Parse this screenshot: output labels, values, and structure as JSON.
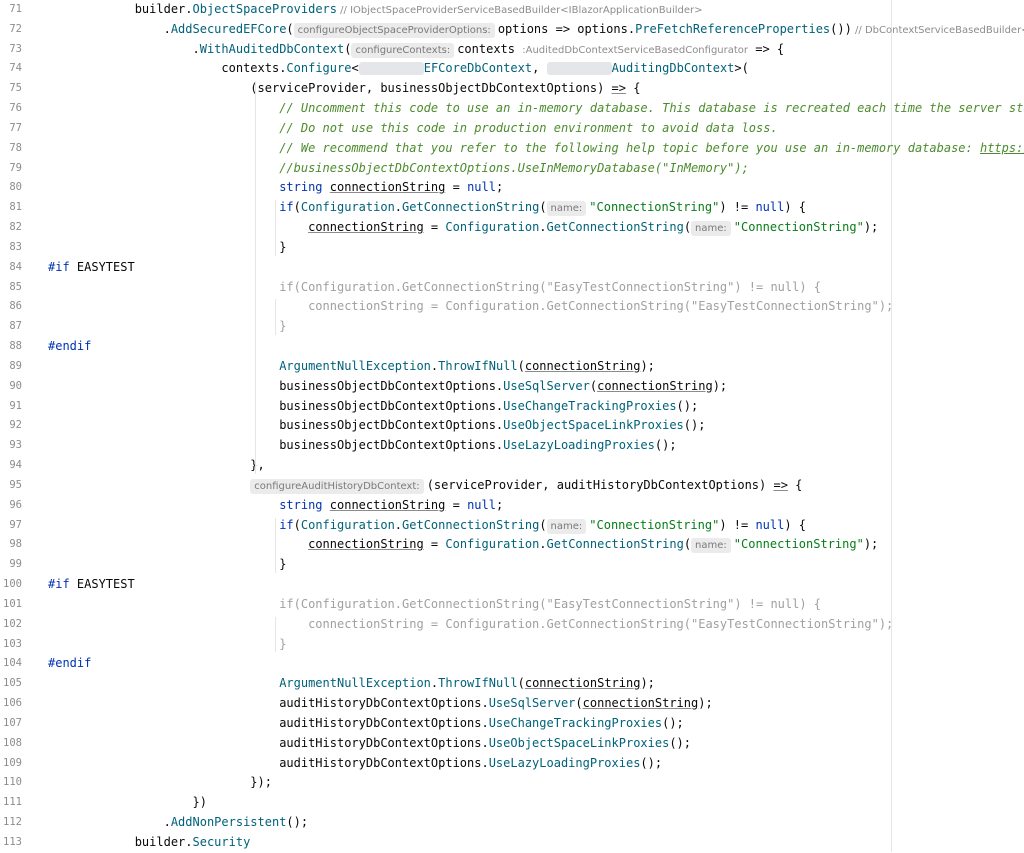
{
  "lines": [
    {
      "n": "71",
      "parts": [
        {
          "t": "            builder."
        },
        {
          "t": "ObjectSpaceProviders",
          "c": "method"
        },
        {
          "t": " // ",
          "c": "hint-plain"
        },
        {
          "t": "IObjectSpaceProviderServiceBasedBuilder<IBlazorApplicationBuilder>",
          "c": "hint-plain"
        }
      ]
    },
    {
      "n": "72",
      "parts": [
        {
          "t": "                ."
        },
        {
          "t": "AddSecuredEFCore",
          "c": "method"
        },
        {
          "t": "("
        },
        {
          "t": "configureObjectSpaceProviderOptions:",
          "c": "hint"
        },
        {
          "t": "options => options."
        },
        {
          "t": "PreFetchReferenceProperties",
          "c": "method"
        },
        {
          "t": "())"
        },
        {
          "t": " // DbContextServiceBasedBuilder<IB",
          "c": "hint-plain"
        }
      ]
    },
    {
      "n": "73",
      "parts": [
        {
          "t": "                    ."
        },
        {
          "t": "WithAuditedDbContext",
          "c": "method"
        },
        {
          "t": "("
        },
        {
          "t": "configureContexts:",
          "c": "hint"
        },
        {
          "t": "contexts "
        },
        {
          "t": ":AuditedDbContextServiceBasedConfigurator",
          "c": "hint-plain"
        },
        {
          "t": " => {"
        }
      ]
    },
    {
      "n": "74",
      "parts": [
        {
          "t": "                        contexts."
        },
        {
          "t": "Configure",
          "c": "method"
        },
        {
          "t": "<"
        },
        {
          "t": "XXXXXXXXX",
          "c": "blur"
        },
        {
          "t": "EFCoreDbContext",
          "c": "method"
        },
        {
          "t": ", "
        },
        {
          "t": "XXXXXXXXX",
          "c": "blur"
        },
        {
          "t": "AuditingDbContext",
          "c": "method"
        },
        {
          "t": ">("
        }
      ]
    },
    {
      "n": "75",
      "parts": [
        {
          "t": "                            (serviceProvider, businessObjectDbContextOptions) "
        },
        {
          "t": "=>",
          "c": "u"
        },
        {
          "t": " {"
        }
      ]
    },
    {
      "n": "76",
      "parts": [
        {
          "t": "                                "
        },
        {
          "t": "// Uncomment this code to use an in-memory database. This database is recreated each time the server starts",
          "c": "cmt-green"
        }
      ]
    },
    {
      "n": "77",
      "parts": [
        {
          "t": "                                "
        },
        {
          "t": "// Do not use this code in production environment to avoid data loss.",
          "c": "cmt-green"
        }
      ]
    },
    {
      "n": "78",
      "parts": [
        {
          "t": "                                "
        },
        {
          "t": "// We recommend that you refer to the following help topic before you use an in-memory database: ",
          "c": "cmt-green"
        },
        {
          "t": "https://do",
          "c": "link"
        }
      ]
    },
    {
      "n": "79",
      "parts": [
        {
          "t": "                                "
        },
        {
          "t": "//businessObjectDbContextOptions.UseInMemoryDatabase(\"InMemory\");",
          "c": "cmt-green"
        }
      ]
    },
    {
      "n": "80",
      "parts": [
        {
          "t": "                                "
        },
        {
          "t": "string",
          "c": "kw"
        },
        {
          "t": " "
        },
        {
          "t": "connectionString",
          "c": "u"
        },
        {
          "t": " = "
        },
        {
          "t": "null",
          "c": "kw"
        },
        {
          "t": ";"
        }
      ]
    },
    {
      "n": "81",
      "parts": [
        {
          "t": "                                "
        },
        {
          "t": "if",
          "c": "kw"
        },
        {
          "t": "("
        },
        {
          "t": "Configuration",
          "c": "method"
        },
        {
          "t": "."
        },
        {
          "t": "GetConnectionString",
          "c": "method"
        },
        {
          "t": "("
        },
        {
          "t": "name:",
          "c": "hint"
        },
        {
          "t": "\"ConnectionString\"",
          "c": "str"
        },
        {
          "t": ") != "
        },
        {
          "t": "null",
          "c": "kw"
        },
        {
          "t": ") {"
        }
      ]
    },
    {
      "n": "82",
      "parts": [
        {
          "t": "                                    "
        },
        {
          "t": "connectionString",
          "c": "u"
        },
        {
          "t": " = "
        },
        {
          "t": "Configuration",
          "c": "method"
        },
        {
          "t": "."
        },
        {
          "t": "GetConnectionString",
          "c": "method"
        },
        {
          "t": "("
        },
        {
          "t": "name:",
          "c": "hint"
        },
        {
          "t": "\"ConnectionString\"",
          "c": "str"
        },
        {
          "t": ");"
        }
      ]
    },
    {
      "n": "83",
      "parts": [
        {
          "t": "                                }"
        }
      ]
    },
    {
      "n": "84",
      "parts": [
        {
          "t": "#if",
          "c": "pp"
        },
        {
          "t": " EASYTEST"
        }
      ]
    },
    {
      "n": "85",
      "parts": [
        {
          "t": "                                if(Configuration.GetConnectionString(\"EasyTestConnectionString\") != null) {",
          "c": "dim"
        }
      ]
    },
    {
      "n": "86",
      "parts": [
        {
          "t": "                                    connectionString = Configuration.GetConnectionString(\"EasyTestConnectionString\");",
          "c": "dim"
        }
      ]
    },
    {
      "n": "87",
      "parts": [
        {
          "t": "                                }",
          "c": "dim"
        }
      ]
    },
    {
      "n": "88",
      "parts": [
        {
          "t": "#endif",
          "c": "pp"
        }
      ]
    },
    {
      "n": "89",
      "parts": [
        {
          "t": "                                "
        },
        {
          "t": "ArgumentNullException",
          "c": "method"
        },
        {
          "t": "."
        },
        {
          "t": "ThrowIfNull",
          "c": "method"
        },
        {
          "t": "("
        },
        {
          "t": "connectionString",
          "c": "u"
        },
        {
          "t": ");"
        }
      ]
    },
    {
      "n": "90",
      "parts": [
        {
          "t": "                                businessObjectDbContextOptions."
        },
        {
          "t": "UseSqlServer",
          "c": "method"
        },
        {
          "t": "("
        },
        {
          "t": "connectionString",
          "c": "u"
        },
        {
          "t": ");"
        }
      ]
    },
    {
      "n": "91",
      "parts": [
        {
          "t": "                                businessObjectDbContextOptions."
        },
        {
          "t": "UseChangeTrackingProxies",
          "c": "method"
        },
        {
          "t": "();"
        }
      ]
    },
    {
      "n": "92",
      "parts": [
        {
          "t": "                                businessObjectDbContextOptions."
        },
        {
          "t": "UseObjectSpaceLinkProxies",
          "c": "method"
        },
        {
          "t": "();"
        }
      ]
    },
    {
      "n": "93",
      "parts": [
        {
          "t": "                                businessObjectDbContextOptions."
        },
        {
          "t": "UseLazyLoadingProxies",
          "c": "method"
        },
        {
          "t": "();"
        }
      ]
    },
    {
      "n": "94",
      "parts": [
        {
          "t": "                            },"
        }
      ]
    },
    {
      "n": "95",
      "parts": [
        {
          "t": "                            "
        },
        {
          "t": "configureAuditHistoryDbContext:",
          "c": "hint"
        },
        {
          "t": "(serviceProvider, auditHistoryDbContextOptions) "
        },
        {
          "t": "=>",
          "c": "u"
        },
        {
          "t": " {"
        }
      ]
    },
    {
      "n": "96",
      "parts": [
        {
          "t": "                                "
        },
        {
          "t": "string",
          "c": "kw"
        },
        {
          "t": " "
        },
        {
          "t": "connectionString",
          "c": "u"
        },
        {
          "t": " = "
        },
        {
          "t": "null",
          "c": "kw"
        },
        {
          "t": ";"
        }
      ]
    },
    {
      "n": "97",
      "parts": [
        {
          "t": "                                "
        },
        {
          "t": "if",
          "c": "kw"
        },
        {
          "t": "("
        },
        {
          "t": "Configuration",
          "c": "method"
        },
        {
          "t": "."
        },
        {
          "t": "GetConnectionString",
          "c": "method"
        },
        {
          "t": "("
        },
        {
          "t": "name:",
          "c": "hint"
        },
        {
          "t": "\"ConnectionString\"",
          "c": "str"
        },
        {
          "t": ") != "
        },
        {
          "t": "null",
          "c": "kw"
        },
        {
          "t": ") {"
        }
      ]
    },
    {
      "n": "98",
      "parts": [
        {
          "t": "                                    "
        },
        {
          "t": "connectionString",
          "c": "u"
        },
        {
          "t": " = "
        },
        {
          "t": "Configuration",
          "c": "method"
        },
        {
          "t": "."
        },
        {
          "t": "GetConnectionString",
          "c": "method"
        },
        {
          "t": "("
        },
        {
          "t": "name:",
          "c": "hint"
        },
        {
          "t": "\"ConnectionString\"",
          "c": "str"
        },
        {
          "t": ");"
        }
      ]
    },
    {
      "n": "99",
      "parts": [
        {
          "t": "                                }"
        }
      ]
    },
    {
      "n": "100",
      "parts": [
        {
          "t": "#if",
          "c": "pp"
        },
        {
          "t": " EASYTEST"
        }
      ]
    },
    {
      "n": "101",
      "parts": [
        {
          "t": "                                if(Configuration.GetConnectionString(\"EasyTestConnectionString\") != null) {",
          "c": "dim"
        }
      ]
    },
    {
      "n": "102",
      "parts": [
        {
          "t": "                                    connectionString = Configuration.GetConnectionString(\"EasyTestConnectionString\");",
          "c": "dim"
        }
      ]
    },
    {
      "n": "103",
      "parts": [
        {
          "t": "                                }",
          "c": "dim"
        }
      ]
    },
    {
      "n": "104",
      "parts": [
        {
          "t": "#endif",
          "c": "pp"
        }
      ]
    },
    {
      "n": "105",
      "parts": [
        {
          "t": "                                "
        },
        {
          "t": "ArgumentNullException",
          "c": "method"
        },
        {
          "t": "."
        },
        {
          "t": "ThrowIfNull",
          "c": "method"
        },
        {
          "t": "("
        },
        {
          "t": "connectionString",
          "c": "u"
        },
        {
          "t": ");"
        }
      ]
    },
    {
      "n": "106",
      "parts": [
        {
          "t": "                                auditHistoryDbContextOptions."
        },
        {
          "t": "UseSqlServer",
          "c": "method"
        },
        {
          "t": "("
        },
        {
          "t": "connectionString",
          "c": "u"
        },
        {
          "t": ");"
        }
      ]
    },
    {
      "n": "107",
      "parts": [
        {
          "t": "                                auditHistoryDbContextOptions."
        },
        {
          "t": "UseChangeTrackingProxies",
          "c": "method"
        },
        {
          "t": "();"
        }
      ]
    },
    {
      "n": "108",
      "parts": [
        {
          "t": "                                auditHistoryDbContextOptions."
        },
        {
          "t": "UseObjectSpaceLinkProxies",
          "c": "method"
        },
        {
          "t": "();"
        }
      ]
    },
    {
      "n": "109",
      "parts": [
        {
          "t": "                                auditHistoryDbContextOptions."
        },
        {
          "t": "UseLazyLoadingProxies",
          "c": "method"
        },
        {
          "t": "();"
        }
      ]
    },
    {
      "n": "110",
      "parts": [
        {
          "t": "                            });"
        }
      ]
    },
    {
      "n": "111",
      "parts": [
        {
          "t": "                    })"
        }
      ]
    },
    {
      "n": "112",
      "parts": [
        {
          "t": "                ."
        },
        {
          "t": "AddNonPersistent",
          "c": "method"
        },
        {
          "t": "();"
        }
      ]
    },
    {
      "n": "113",
      "parts": [
        {
          "t": "            builder."
        },
        {
          "t": "Security",
          "c": "method"
        }
      ]
    }
  ]
}
